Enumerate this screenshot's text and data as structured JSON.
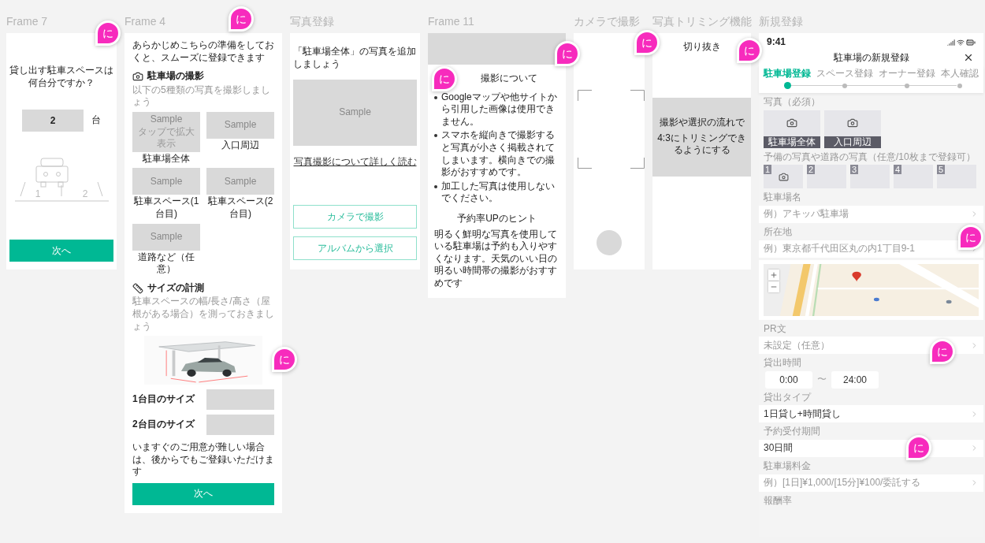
{
  "frames": [
    {
      "kind": "count",
      "title": "Frame 7",
      "question": [
        "貸し出す駐車スペースは",
        "何台分ですか？"
      ],
      "value": "2",
      "unit": "台",
      "slots": [
        "1",
        "2"
      ],
      "button": "次へ"
    },
    {
      "kind": "prep",
      "title": "Frame 4",
      "intro": "あらかじめこちらの準備をしておくと、スムーズに登録できます",
      "photo_heading": "駐車場の撮影",
      "photo_hint": "以下の5種類の写真を撮影しましょう",
      "samples": [
        {
          "label": "Sample",
          "sub": "タップで拡大表示",
          "caption": "駐車場全体"
        },
        {
          "label": "Sample",
          "caption": "入口周辺"
        },
        {
          "label": "Sample",
          "caption": "駐車スペース(1台目)"
        },
        {
          "label": "Sample",
          "caption": "駐車スペース(2台目)"
        },
        {
          "label": "Sample",
          "caption": "道路など（任意）"
        }
      ],
      "size_heading": "サイズの計測",
      "size_hint": "駐車スペースの幅/長さ/高さ（屋根がある場合）を測っておきましょう",
      "size_rows": [
        "1台目のサイズ",
        "2台目のサイズ"
      ],
      "note": "いますぐのご用意が難しい場合は、後からでもご登録いただけます",
      "button": "次へ"
    },
    {
      "title": "写真登録",
      "heading": "「駐車場全体」の写真を追加しましょう",
      "sample": "Sample",
      "link": "写真撮影について詳しく読む",
      "buttons": [
        "カメラで撮影",
        "アルバムから選択"
      ]
    },
    {
      "kind": "tips",
      "title": "Frame 11",
      "heading": "撮影について",
      "bullets": [
        "Googleマップや他サイトから引用した画像は使用できません。",
        "スマホを縦向きで撮影すると写真が小さく掲載されてしまいます。横向きでの撮影がおすすめです。",
        "加工した写真は使用しないでください。"
      ],
      "hint_heading": "予約率UPのヒント",
      "hint": "明るく鮮明な写真を使用している駐車場は予約も入りやすくなります。天気のいい日の明るい時間帯の撮影がおすすめです"
    },
    {
      "kind": "camera",
      "title": "カメラで撮影"
    },
    {
      "kind": "trim",
      "title": "写真トリミング機能",
      "heading": "切り抜き",
      "note": [
        "撮影や選択の流れで",
        "4:3にトリミングできるようにする"
      ]
    },
    {
      "kind": "form",
      "title": "新規登録",
      "status_time": "9:41",
      "header": "駐車場の新規登録",
      "steps": [
        {
          "label": "駐車場登録",
          "selected": true
        },
        {
          "label": "スペース登録",
          "selected": false
        },
        {
          "label": "オーナー登録",
          "selected": false
        },
        {
          "label": "本人確認",
          "selected": false
        }
      ],
      "sections": [
        {
          "kind": "photos",
          "label": "写真（必須）",
          "tiles": [
            "駐車場全体",
            "入口周辺"
          ]
        },
        {
          "kind": "spare",
          "label": "予備の写真や道路の写真（任意/10枚まで登録可）",
          "tiles": [
            "1",
            "2",
            "3",
            "4",
            "5"
          ]
        },
        {
          "kind": "field",
          "label": "駐車場名",
          "placeholder": "例）アキッパ駐車場"
        },
        {
          "kind": "field",
          "label": "所在地",
          "placeholder": "例）東京都千代田区丸の内1丁目9-1"
        },
        {
          "kind": "map"
        },
        {
          "kind": "field",
          "label": "PR文",
          "placeholder": "未設定（任意）"
        },
        {
          "kind": "time",
          "label": "貸出時間",
          "from": "0:00",
          "sep": "〜",
          "to": "24:00"
        },
        {
          "kind": "field",
          "label": "貸出タイプ",
          "value": "1日貸し+時間貸し"
        },
        {
          "kind": "field",
          "label": "予約受付期間",
          "value": "30日間"
        },
        {
          "kind": "field",
          "label": "駐車場料金",
          "placeholder": "例）[1日]¥1,000/[15分]¥100/委託する"
        },
        {
          "kind": "label",
          "label": "報酬率"
        }
      ]
    }
  ],
  "comments": [
    "に",
    "に",
    "に",
    "に",
    "に",
    "に",
    "に",
    "に",
    "に",
    "に"
  ]
}
